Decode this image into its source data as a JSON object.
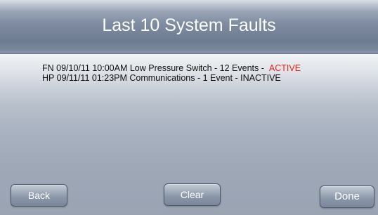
{
  "header": {
    "title": "Last 10 System Faults"
  },
  "faults": [
    {
      "text": "FN 09/10/11 10:00AM Low Pressure Switch - 12 Events -",
      "status": "ACTIVE",
      "status_color": "#e8201d"
    },
    {
      "text": "HP 09/11/11  01:23PM Communications - 1 Event -",
      "status": "INACTIVE",
      "status_color": "#111111"
    }
  ],
  "buttons": {
    "back_label": "Back",
    "clear_label": "Clear",
    "done_label": "Done"
  }
}
